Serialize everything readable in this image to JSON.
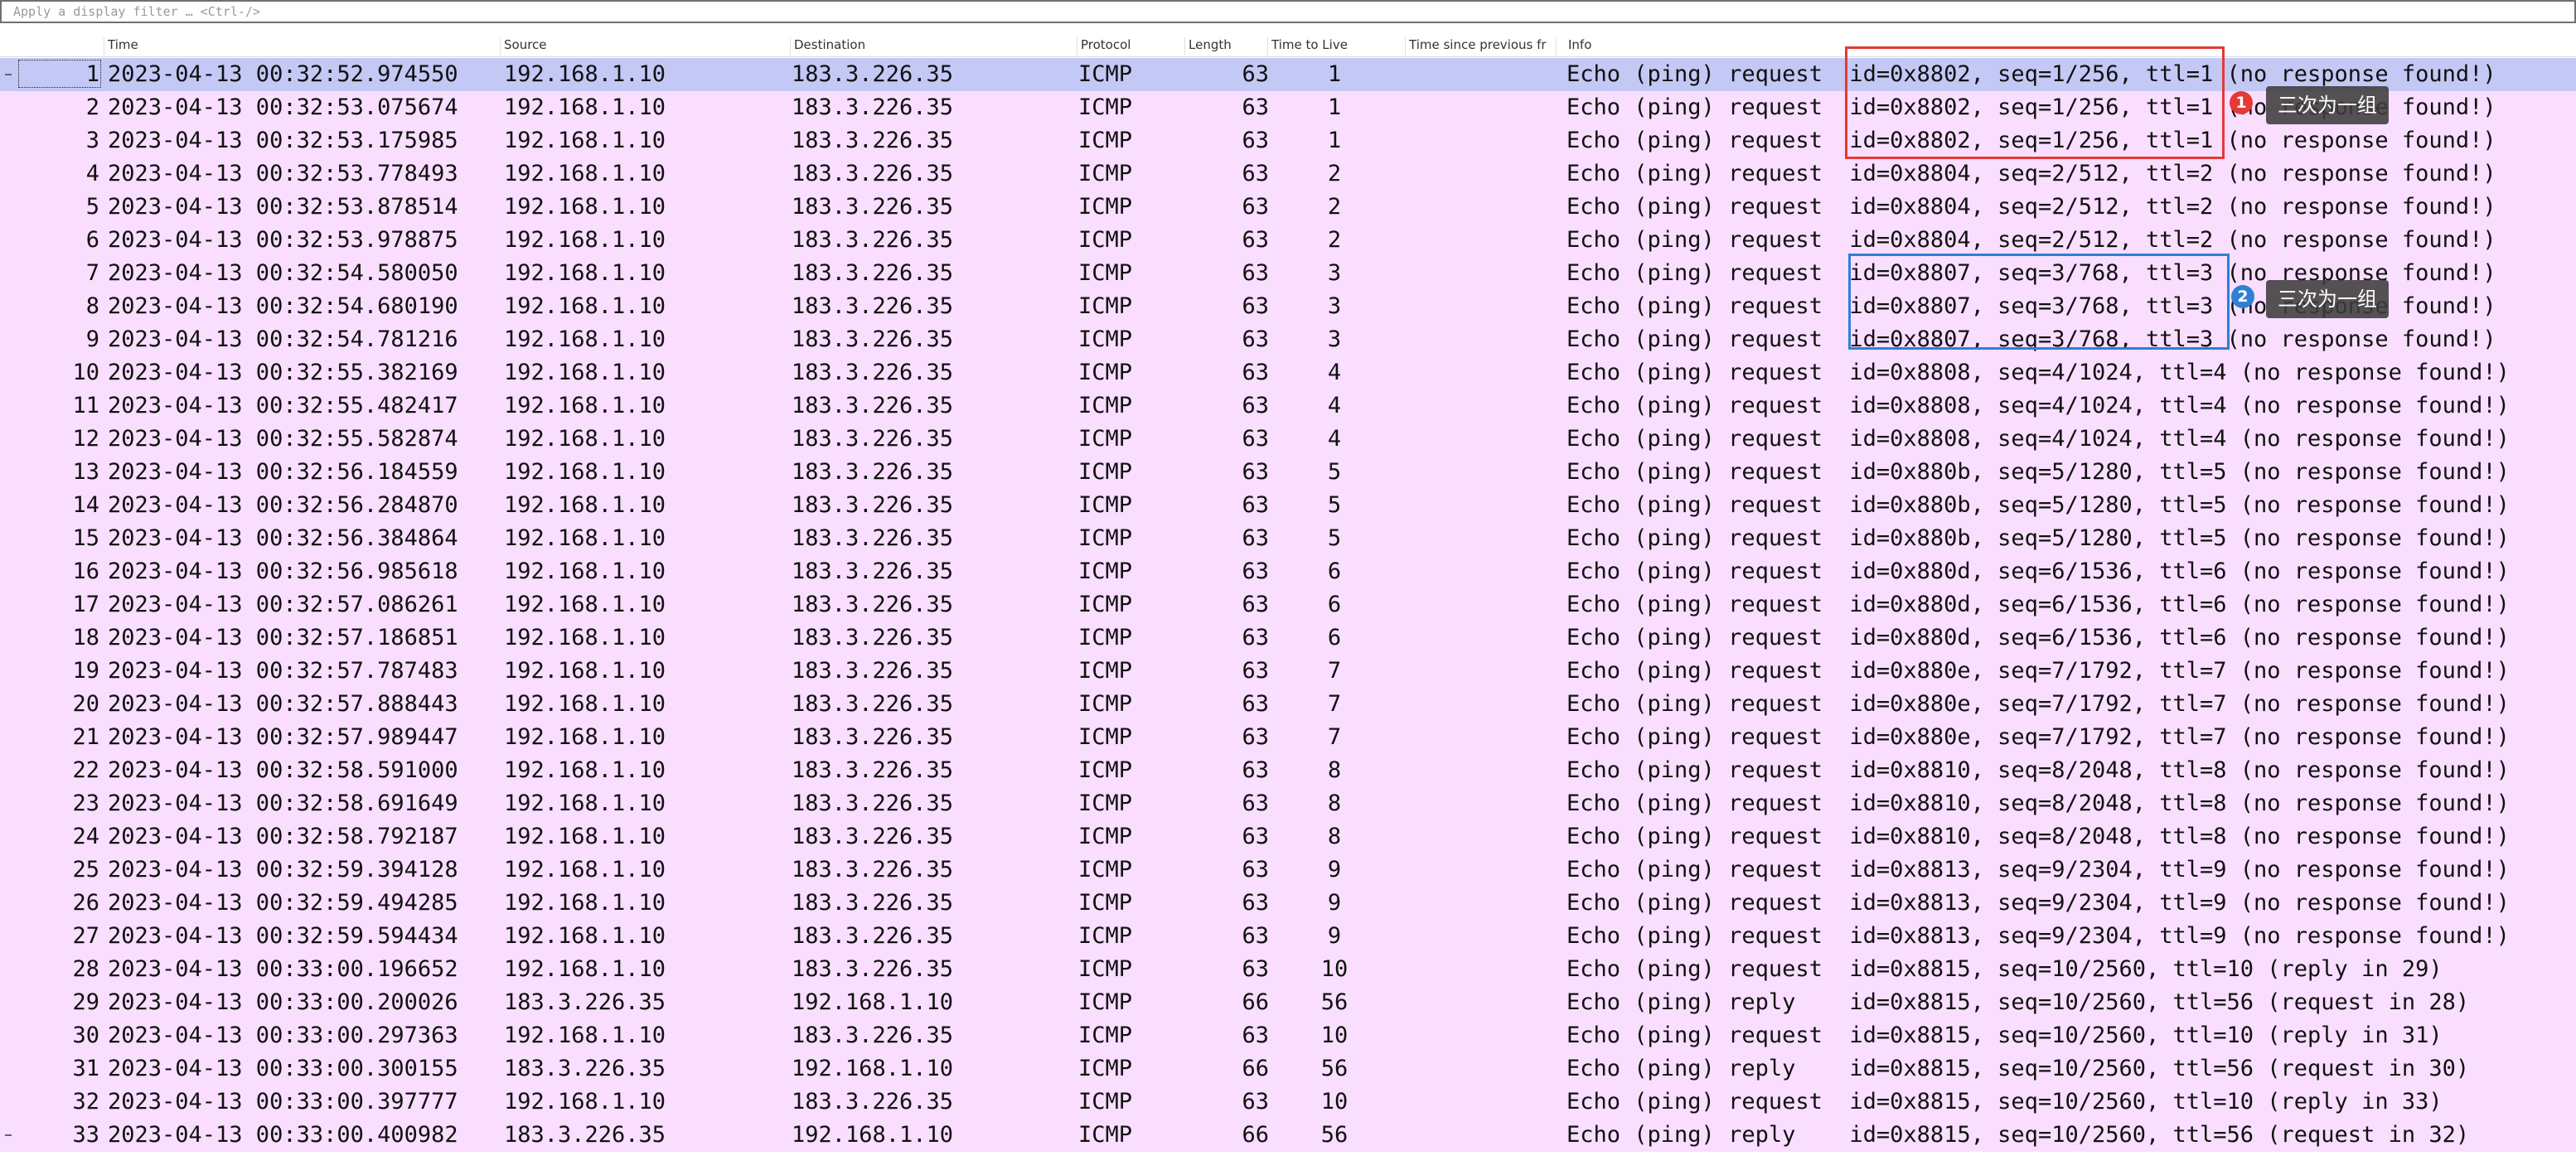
{
  "filter": {
    "placeholder": "Apply a display filter … <Ctrl-/>"
  },
  "columns": {
    "no": "",
    "time": "Time",
    "source": "Source",
    "destination": "Destination",
    "protocol": "Protocol",
    "length": "Length",
    "ttl": "Time to Live",
    "time_since_prev": "Time since previous fr",
    "info": "Info"
  },
  "colors": {
    "row_bg": "#f9deff",
    "selected_bg": "#c3c8f5",
    "annotation_red": "#e53935",
    "annotation_blue": "#2f80d1"
  },
  "packets": [
    {
      "no": "1",
      "time": "2023-04-13 00:32:52.974550",
      "src": "192.168.1.10",
      "dst": "183.3.226.35",
      "proto": "ICMP",
      "len": "63",
      "ttl": "1",
      "info": "Echo (ping) request  id=0x8802, seq=1/256, ttl=1 (no response found!)"
    },
    {
      "no": "2",
      "time": "2023-04-13 00:32:53.075674",
      "src": "192.168.1.10",
      "dst": "183.3.226.35",
      "proto": "ICMP",
      "len": "63",
      "ttl": "1",
      "info": "Echo (ping) request  id=0x8802, seq=1/256, ttl=1 (no response found!)"
    },
    {
      "no": "3",
      "time": "2023-04-13 00:32:53.175985",
      "src": "192.168.1.10",
      "dst": "183.3.226.35",
      "proto": "ICMP",
      "len": "63",
      "ttl": "1",
      "info": "Echo (ping) request  id=0x8802, seq=1/256, ttl=1 (no response found!)"
    },
    {
      "no": "4",
      "time": "2023-04-13 00:32:53.778493",
      "src": "192.168.1.10",
      "dst": "183.3.226.35",
      "proto": "ICMP",
      "len": "63",
      "ttl": "2",
      "info": "Echo (ping) request  id=0x8804, seq=2/512, ttl=2 (no response found!)"
    },
    {
      "no": "5",
      "time": "2023-04-13 00:32:53.878514",
      "src": "192.168.1.10",
      "dst": "183.3.226.35",
      "proto": "ICMP",
      "len": "63",
      "ttl": "2",
      "info": "Echo (ping) request  id=0x8804, seq=2/512, ttl=2 (no response found!)"
    },
    {
      "no": "6",
      "time": "2023-04-13 00:32:53.978875",
      "src": "192.168.1.10",
      "dst": "183.3.226.35",
      "proto": "ICMP",
      "len": "63",
      "ttl": "2",
      "info": "Echo (ping) request  id=0x8804, seq=2/512, ttl=2 (no response found!)"
    },
    {
      "no": "7",
      "time": "2023-04-13 00:32:54.580050",
      "src": "192.168.1.10",
      "dst": "183.3.226.35",
      "proto": "ICMP",
      "len": "63",
      "ttl": "3",
      "info": "Echo (ping) request  id=0x8807, seq=3/768, ttl=3 (no response found!)"
    },
    {
      "no": "8",
      "time": "2023-04-13 00:32:54.680190",
      "src": "192.168.1.10",
      "dst": "183.3.226.35",
      "proto": "ICMP",
      "len": "63",
      "ttl": "3",
      "info": "Echo (ping) request  id=0x8807, seq=3/768, ttl=3 (no response found!)"
    },
    {
      "no": "9",
      "time": "2023-04-13 00:32:54.781216",
      "src": "192.168.1.10",
      "dst": "183.3.226.35",
      "proto": "ICMP",
      "len": "63",
      "ttl": "3",
      "info": "Echo (ping) request  id=0x8807, seq=3/768, ttl=3 (no response found!)"
    },
    {
      "no": "10",
      "time": "2023-04-13 00:32:55.382169",
      "src": "192.168.1.10",
      "dst": "183.3.226.35",
      "proto": "ICMP",
      "len": "63",
      "ttl": "4",
      "info": "Echo (ping) request  id=0x8808, seq=4/1024, ttl=4 (no response found!)"
    },
    {
      "no": "11",
      "time": "2023-04-13 00:32:55.482417",
      "src": "192.168.1.10",
      "dst": "183.3.226.35",
      "proto": "ICMP",
      "len": "63",
      "ttl": "4",
      "info": "Echo (ping) request  id=0x8808, seq=4/1024, ttl=4 (no response found!)"
    },
    {
      "no": "12",
      "time": "2023-04-13 00:32:55.582874",
      "src": "192.168.1.10",
      "dst": "183.3.226.35",
      "proto": "ICMP",
      "len": "63",
      "ttl": "4",
      "info": "Echo (ping) request  id=0x8808, seq=4/1024, ttl=4 (no response found!)"
    },
    {
      "no": "13",
      "time": "2023-04-13 00:32:56.184559",
      "src": "192.168.1.10",
      "dst": "183.3.226.35",
      "proto": "ICMP",
      "len": "63",
      "ttl": "5",
      "info": "Echo (ping) request  id=0x880b, seq=5/1280, ttl=5 (no response found!)"
    },
    {
      "no": "14",
      "time": "2023-04-13 00:32:56.284870",
      "src": "192.168.1.10",
      "dst": "183.3.226.35",
      "proto": "ICMP",
      "len": "63",
      "ttl": "5",
      "info": "Echo (ping) request  id=0x880b, seq=5/1280, ttl=5 (no response found!)"
    },
    {
      "no": "15",
      "time": "2023-04-13 00:32:56.384864",
      "src": "192.168.1.10",
      "dst": "183.3.226.35",
      "proto": "ICMP",
      "len": "63",
      "ttl": "5",
      "info": "Echo (ping) request  id=0x880b, seq=5/1280, ttl=5 (no response found!)"
    },
    {
      "no": "16",
      "time": "2023-04-13 00:32:56.985618",
      "src": "192.168.1.10",
      "dst": "183.3.226.35",
      "proto": "ICMP",
      "len": "63",
      "ttl": "6",
      "info": "Echo (ping) request  id=0x880d, seq=6/1536, ttl=6 (no response found!)"
    },
    {
      "no": "17",
      "time": "2023-04-13 00:32:57.086261",
      "src": "192.168.1.10",
      "dst": "183.3.226.35",
      "proto": "ICMP",
      "len": "63",
      "ttl": "6",
      "info": "Echo (ping) request  id=0x880d, seq=6/1536, ttl=6 (no response found!)"
    },
    {
      "no": "18",
      "time": "2023-04-13 00:32:57.186851",
      "src": "192.168.1.10",
      "dst": "183.3.226.35",
      "proto": "ICMP",
      "len": "63",
      "ttl": "6",
      "info": "Echo (ping) request  id=0x880d, seq=6/1536, ttl=6 (no response found!)"
    },
    {
      "no": "19",
      "time": "2023-04-13 00:32:57.787483",
      "src": "192.168.1.10",
      "dst": "183.3.226.35",
      "proto": "ICMP",
      "len": "63",
      "ttl": "7",
      "info": "Echo (ping) request  id=0x880e, seq=7/1792, ttl=7 (no response found!)"
    },
    {
      "no": "20",
      "time": "2023-04-13 00:32:57.888443",
      "src": "192.168.1.10",
      "dst": "183.3.226.35",
      "proto": "ICMP",
      "len": "63",
      "ttl": "7",
      "info": "Echo (ping) request  id=0x880e, seq=7/1792, ttl=7 (no response found!)"
    },
    {
      "no": "21",
      "time": "2023-04-13 00:32:57.989447",
      "src": "192.168.1.10",
      "dst": "183.3.226.35",
      "proto": "ICMP",
      "len": "63",
      "ttl": "7",
      "info": "Echo (ping) request  id=0x880e, seq=7/1792, ttl=7 (no response found!)"
    },
    {
      "no": "22",
      "time": "2023-04-13 00:32:58.591000",
      "src": "192.168.1.10",
      "dst": "183.3.226.35",
      "proto": "ICMP",
      "len": "63",
      "ttl": "8",
      "info": "Echo (ping) request  id=0x8810, seq=8/2048, ttl=8 (no response found!)"
    },
    {
      "no": "23",
      "time": "2023-04-13 00:32:58.691649",
      "src": "192.168.1.10",
      "dst": "183.3.226.35",
      "proto": "ICMP",
      "len": "63",
      "ttl": "8",
      "info": "Echo (ping) request  id=0x8810, seq=8/2048, ttl=8 (no response found!)"
    },
    {
      "no": "24",
      "time": "2023-04-13 00:32:58.792187",
      "src": "192.168.1.10",
      "dst": "183.3.226.35",
      "proto": "ICMP",
      "len": "63",
      "ttl": "8",
      "info": "Echo (ping) request  id=0x8810, seq=8/2048, ttl=8 (no response found!)"
    },
    {
      "no": "25",
      "time": "2023-04-13 00:32:59.394128",
      "src": "192.168.1.10",
      "dst": "183.3.226.35",
      "proto": "ICMP",
      "len": "63",
      "ttl": "9",
      "info": "Echo (ping) request  id=0x8813, seq=9/2304, ttl=9 (no response found!)"
    },
    {
      "no": "26",
      "time": "2023-04-13 00:32:59.494285",
      "src": "192.168.1.10",
      "dst": "183.3.226.35",
      "proto": "ICMP",
      "len": "63",
      "ttl": "9",
      "info": "Echo (ping) request  id=0x8813, seq=9/2304, ttl=9 (no response found!)"
    },
    {
      "no": "27",
      "time": "2023-04-13 00:32:59.594434",
      "src": "192.168.1.10",
      "dst": "183.3.226.35",
      "proto": "ICMP",
      "len": "63",
      "ttl": "9",
      "info": "Echo (ping) request  id=0x8813, seq=9/2304, ttl=9 (no response found!)"
    },
    {
      "no": "28",
      "time": "2023-04-13 00:33:00.196652",
      "src": "192.168.1.10",
      "dst": "183.3.226.35",
      "proto": "ICMP",
      "len": "63",
      "ttl": "10",
      "info": "Echo (ping) request  id=0x8815, seq=10/2560, ttl=10 (reply in 29)"
    },
    {
      "no": "29",
      "time": "2023-04-13 00:33:00.200026",
      "src": "183.3.226.35",
      "dst": "192.168.1.10",
      "proto": "ICMP",
      "len": "66",
      "ttl": "56",
      "info": "Echo (ping) reply    id=0x8815, seq=10/2560, ttl=56 (request in 28)"
    },
    {
      "no": "30",
      "time": "2023-04-13 00:33:00.297363",
      "src": "192.168.1.10",
      "dst": "183.3.226.35",
      "proto": "ICMP",
      "len": "63",
      "ttl": "10",
      "info": "Echo (ping) request  id=0x8815, seq=10/2560, ttl=10 (reply in 31)"
    },
    {
      "no": "31",
      "time": "2023-04-13 00:33:00.300155",
      "src": "183.3.226.35",
      "dst": "192.168.1.10",
      "proto": "ICMP",
      "len": "66",
      "ttl": "56",
      "info": "Echo (ping) reply    id=0x8815, seq=10/2560, ttl=56 (request in 30)"
    },
    {
      "no": "32",
      "time": "2023-04-13 00:33:00.397777",
      "src": "192.168.1.10",
      "dst": "183.3.226.35",
      "proto": "ICMP",
      "len": "63",
      "ttl": "10",
      "info": "Echo (ping) request  id=0x8815, seq=10/2560, ttl=10 (reply in 33)"
    },
    {
      "no": "33",
      "time": "2023-04-13 00:33:00.400982",
      "src": "183.3.226.35",
      "dst": "192.168.1.10",
      "proto": "ICMP",
      "len": "66",
      "ttl": "56",
      "info": "Echo (ping) reply    id=0x8815, seq=10/2560, ttl=56 (request in 32)"
    }
  ],
  "annotations": [
    {
      "badge": "1",
      "label": "三次为一组"
    },
    {
      "badge": "2",
      "label": "三次为一组"
    }
  ]
}
